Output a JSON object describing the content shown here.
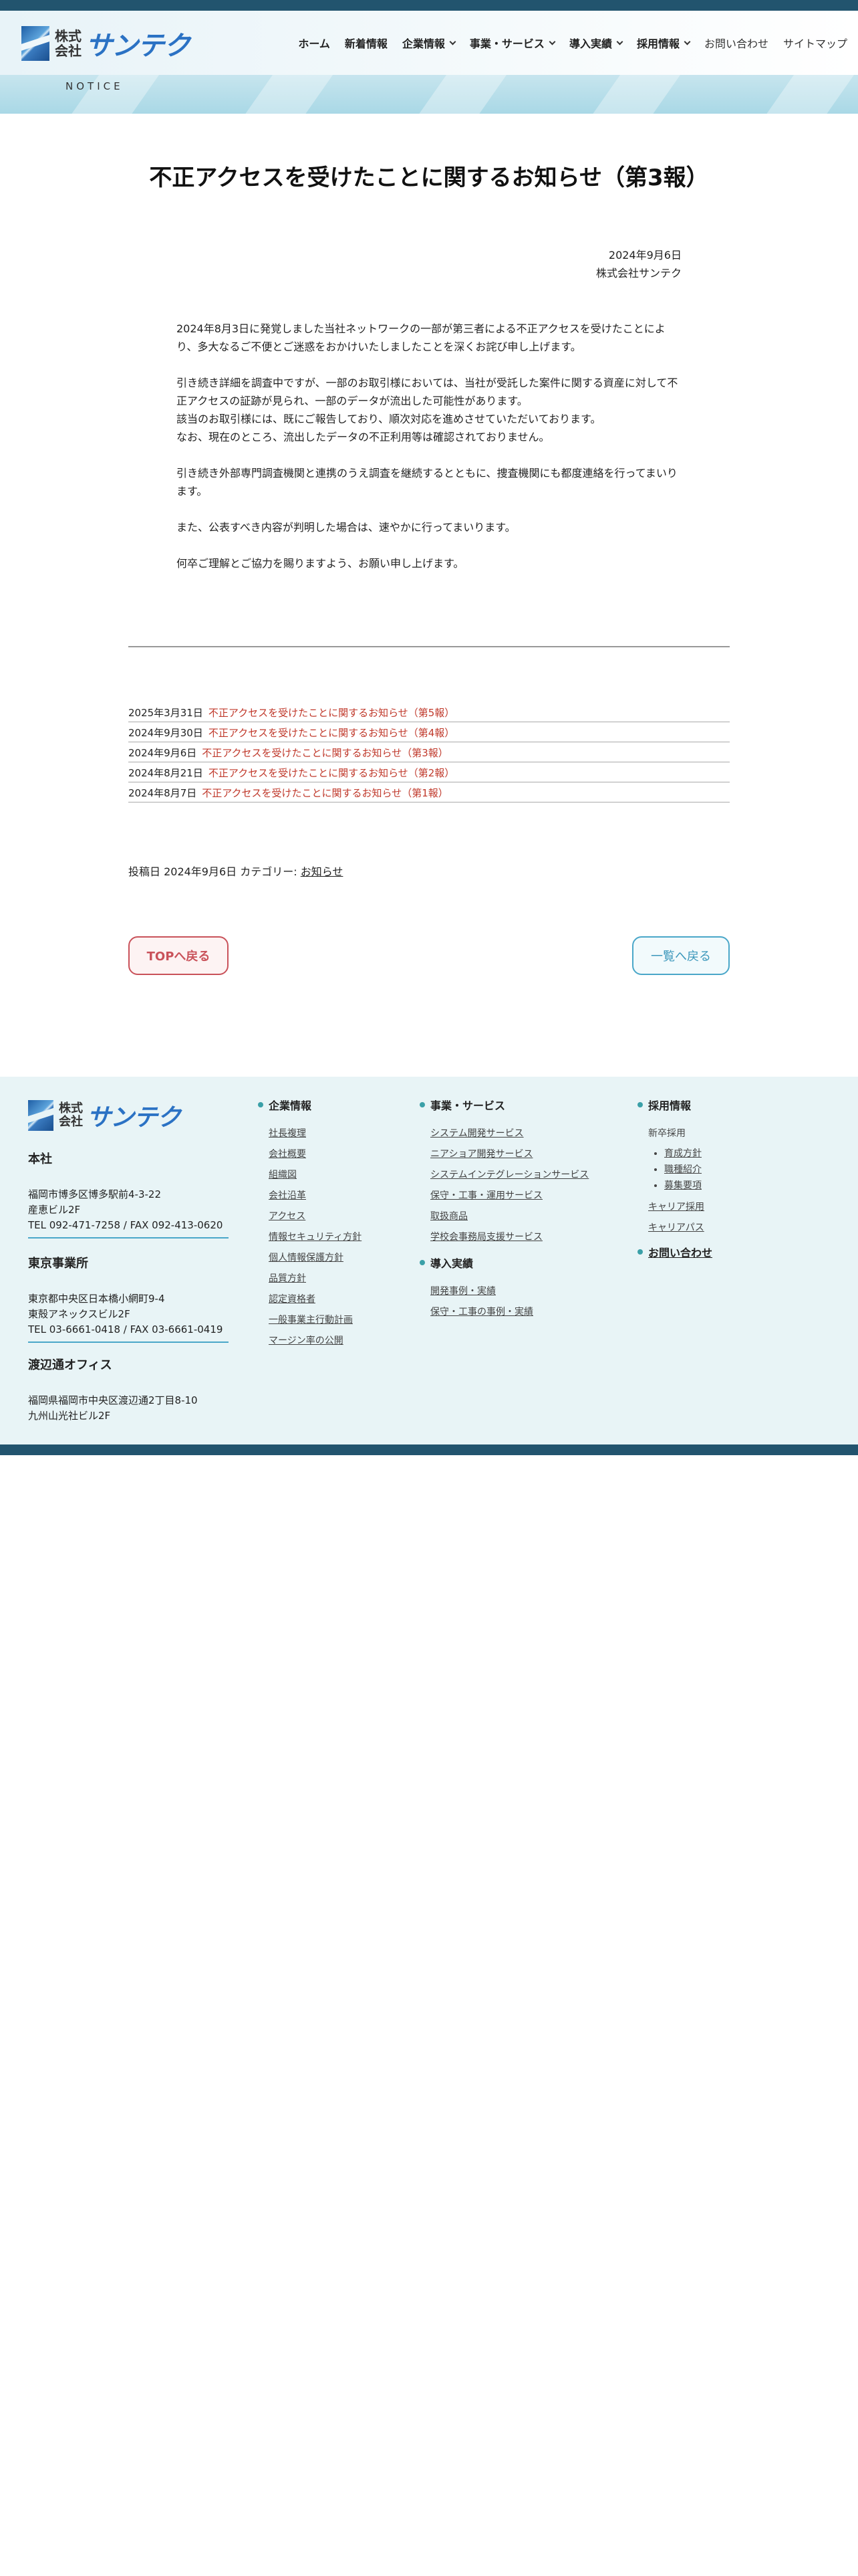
{
  "header": {
    "logo_kk_line1": "株式",
    "logo_kk_line2": "会社",
    "logo_name": "サンテク",
    "nav": [
      {
        "label": "ホーム",
        "dropdown": false,
        "bold": true
      },
      {
        "label": "新着情報",
        "dropdown": false,
        "bold": true
      },
      {
        "label": "企業情報",
        "dropdown": true,
        "bold": true
      },
      {
        "label": "事業・サービス",
        "dropdown": true,
        "bold": true
      },
      {
        "label": "導入実績",
        "dropdown": true,
        "bold": true
      },
      {
        "label": "採用情報",
        "dropdown": true,
        "bold": true
      },
      {
        "label": "お問い合わせ",
        "dropdown": false,
        "bold": false
      },
      {
        "label": "サイトマップ",
        "dropdown": false,
        "bold": false
      }
    ]
  },
  "banner": {
    "label": "NOTICE"
  },
  "article": {
    "title": "不正アクセスを受けたことに関するお知らせ（第3報）",
    "date": "2024年9月6日",
    "company": "株式会社サンテク",
    "paragraphs": [
      "2024年8月3日に発覚しました当社ネットワークの一部が第三者による不正アクセスを受けたことにより、多大なるご不便とご迷惑をおかけいたしましたことを深くお詫び申し上げます。",
      "引き続き詳細を調査中ですが、一部のお取引様においては、当社が受託した案件に関する資産に対して不正アクセスの証跡が見られ、一部のデータが流出した可能性があります。\n該当のお取引様には、既にご報告しており、順次対応を進めさせていただいております。\nなお、現在のところ、流出したデータの不正利用等は確認されておりません。",
      "引き続き外部専門調査機関と連携のうえ調査を継続するとともに、捜査機関にも都度連絡を行ってまいります。",
      "また、公表すべき内容が判明した場合は、速やかに行ってまいります。",
      "何卒ご理解とご協力を賜りますよう、お願い申し上げます。"
    ]
  },
  "related": [
    {
      "date": "2025年3月31日",
      "title": "不正アクセスを受けたことに関するお知らせ（第5報）"
    },
    {
      "date": "2024年9月30日",
      "title": "不正アクセスを受けたことに関するお知らせ（第4報）"
    },
    {
      "date": "2024年9月6日",
      "title": "不正アクセスを受けたことに関するお知らせ（第3報）"
    },
    {
      "date": "2024年8月21日",
      "title": "不正アクセスを受けたことに関するお知らせ（第2報）"
    },
    {
      "date": "2024年8月7日",
      "title": "不正アクセスを受けたことに関するお知らせ（第1報）"
    }
  ],
  "meta": {
    "prefix": "投稿日 2024年9月6日 カテゴリー: ",
    "category": "お知らせ"
  },
  "buttons": {
    "top": "TOPへ戻る",
    "list": "一覧へ戻る"
  },
  "footer": {
    "offices": [
      {
        "name": "本社",
        "lines": [
          "福岡市博多区博多駅前4-3-22",
          "産恵ビル2F",
          "TEL 092-471-7258 / FAX 092-413-0620"
        ]
      },
      {
        "name": "東京事業所",
        "lines": [
          "東京都中央区日本橋小網町9-4",
          "東殻アネックスビル2F",
          "TEL 03-6661-0418 / FAX 03-6661-0419"
        ]
      },
      {
        "name": "渡辺通オフィス",
        "lines": [
          "福岡県福岡市中央区渡辺通2丁目8-10",
          "九州山光社ビル2F"
        ]
      }
    ],
    "company": {
      "heading": "企業情報",
      "links": [
        "社長複理",
        "会社概要",
        "組織図",
        "会社沿革",
        "アクセス",
        "情報セキュリティ方針",
        "個人情報保護方針",
        "品質方針",
        "認定資格者",
        "一般事業主行動計画",
        "マージン率の公開"
      ]
    },
    "services": {
      "heading": "事業・サービス",
      "links": [
        "システム開発サービス",
        "ニアショア開発サービス",
        "システムインテグレーションサービス",
        "保守・工事・運用サービス",
        "取扱商品",
        "学校会事務局支援サービス"
      ]
    },
    "works": {
      "heading": "導入実績",
      "links": [
        "開発事例・実績",
        "保守・工事の事例・実績"
      ]
    },
    "recruit": {
      "heading": "採用情報",
      "new_grad": "新卒採用",
      "new_grad_links": [
        "育成方針",
        "職種紹介",
        "募集要項"
      ],
      "links": [
        "キャリア採用",
        "キャリアパス"
      ]
    },
    "contact": "お問い合わせ"
  }
}
